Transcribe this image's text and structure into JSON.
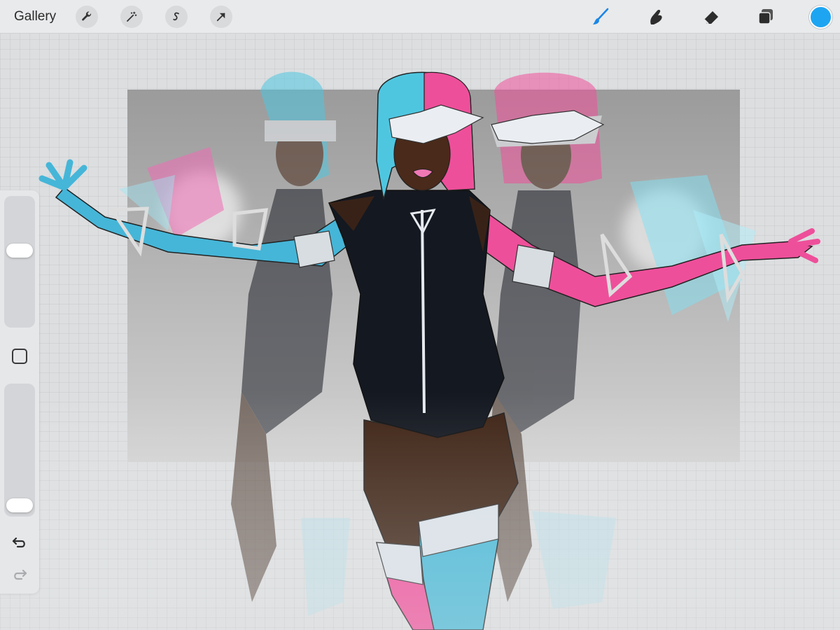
{
  "toolbar": {
    "gallery_label": "Gallery",
    "left_tools": [
      "wrench-icon",
      "magic-wand-icon",
      "selection-s-icon",
      "transform-arrow-icon"
    ],
    "right_tools": [
      "brush-icon",
      "smudge-icon",
      "eraser-icon",
      "layers-icon"
    ],
    "active_tool": "brush",
    "active_color": "#1ea5f2",
    "accent_color": "#1a86e8"
  },
  "sidebar": {
    "brush_size_level": 0.6,
    "opacity_level": 0.0,
    "icons": [
      "square-modify-icon",
      "undo-icon",
      "redo-icon"
    ]
  },
  "palette": {
    "cyan": "#4fc6e0",
    "pink": "#f0509a",
    "skin": "#4a2a1a",
    "suit": "#141820",
    "canvas_bg": "#a9a9a9"
  }
}
